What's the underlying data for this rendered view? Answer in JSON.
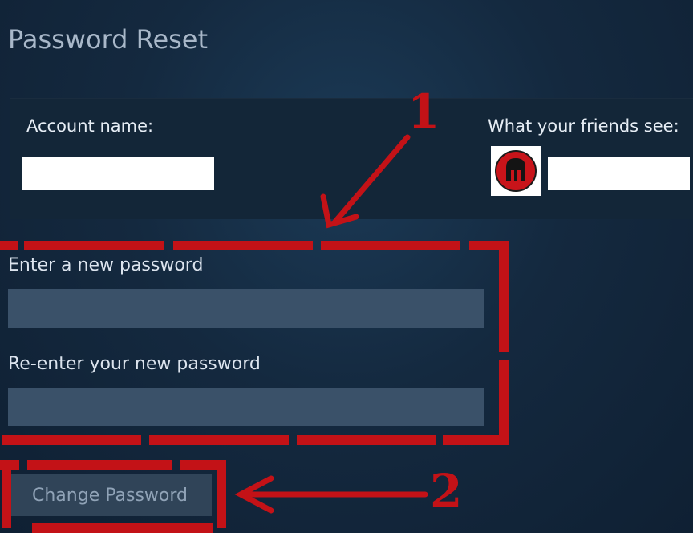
{
  "page": {
    "title": "Password Reset"
  },
  "account": {
    "name_label": "Account name:",
    "friends_label": "What your friends see:"
  },
  "form": {
    "new_password_label": "Enter a new password",
    "reenter_password_label": "Re-enter your new password",
    "submit_label": "Change Password"
  },
  "annotations": {
    "step_1": "1",
    "step_2": "2"
  },
  "icons": {
    "avatar": "spartan-helmet-icon"
  },
  "colors": {
    "background": "#14293f",
    "input_fill": "#3a5169",
    "button_fill": "#304458",
    "button_text": "#90a3b7",
    "annotation": "#c31217"
  }
}
